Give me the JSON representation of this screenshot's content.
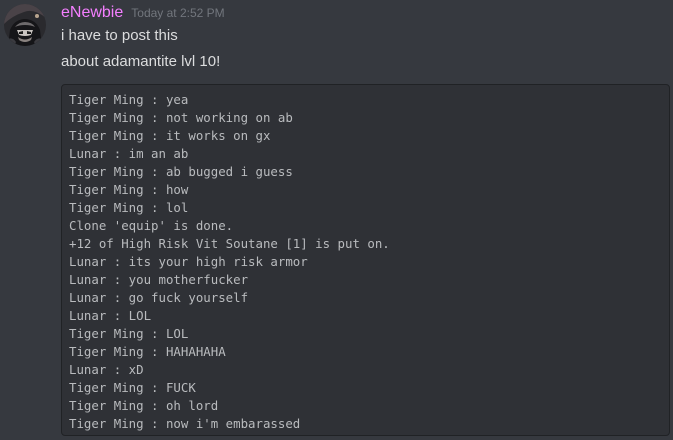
{
  "message": {
    "username": "eNewbie",
    "timestamp": "Today at 2:52 PM",
    "username_color": "#f47fff",
    "lines": [
      "i have to post this",
      "about adamantite lvl 10!"
    ],
    "code_lines": [
      "Tiger Ming : yea",
      "Tiger Ming : not working on ab",
      "Tiger Ming : it works on gx",
      "Lunar : im an ab",
      "Tiger Ming : ab bugged i guess",
      "Tiger Ming : how",
      "Tiger Ming : lol",
      "Clone 'equip' is done.",
      "+12 of High Risk Vit Soutane [1] is put on.",
      "Lunar : its your high risk armor",
      "Lunar : you motherfucker",
      "Lunar : go fuck yourself",
      "Lunar : LOL",
      "Tiger Ming : LOL",
      "Tiger Ming : HAHAHAHA",
      "Lunar : xD",
      "Tiger Ming : FUCK",
      "Tiger Ming : oh lord",
      "Tiger Ming : now i'm embarassed"
    ]
  },
  "colors": {
    "background": "#36393f",
    "codeblock_background": "#2f3136",
    "text": "#dcddde",
    "timestamp": "#72767d"
  },
  "icons": {
    "avatar": "user-avatar"
  }
}
